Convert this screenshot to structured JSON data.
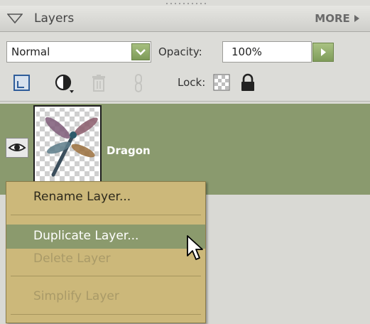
{
  "panel": {
    "title": "Layers",
    "more_label": "MORE"
  },
  "controls": {
    "blend_mode": "Normal",
    "opacity_label": "Opacity:",
    "opacity_value": "100%",
    "lock_label": "Lock:"
  },
  "layers": [
    {
      "name": "Dragon",
      "visible": true,
      "selected": true
    }
  ],
  "context_menu": {
    "items": [
      {
        "label": "Rename Layer...",
        "enabled": true,
        "highlighted": false
      },
      {
        "label": "Duplicate Layer...",
        "enabled": true,
        "highlighted": true
      },
      {
        "label": "Delete Layer",
        "enabled": false,
        "highlighted": false
      },
      {
        "label": "Simplify Layer",
        "enabled": false,
        "highlighted": false
      }
    ]
  },
  "icons": {
    "panel_toggle": "collapse-triangle-icon",
    "more": "more-arrow-icon",
    "new_layer": "new-layer-icon",
    "adjustment": "adjustment-layer-icon",
    "delete": "trash-icon",
    "link": "link-icon",
    "lock_transparent": "lock-transparency-icon",
    "lock_all": "padlock-icon",
    "visibility": "eye-icon",
    "cursor": "arrow-cursor-icon"
  },
  "colors": {
    "selected_layer": "#8a9a6e",
    "menu_bg": "#ccb87a",
    "menu_highlight": "#8b9a6d",
    "accent_green": "#8aa866"
  }
}
